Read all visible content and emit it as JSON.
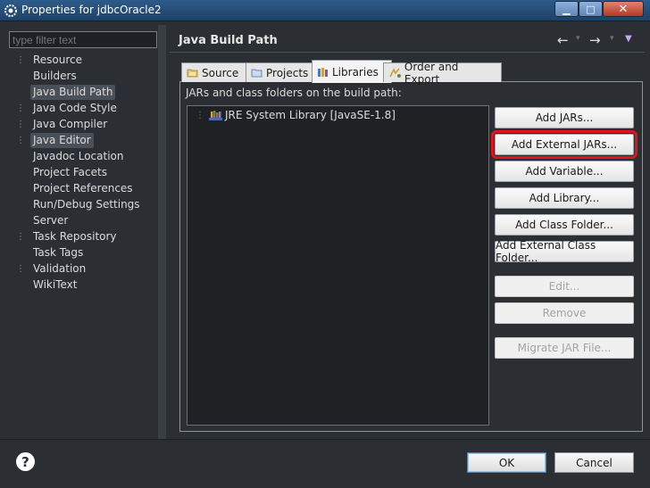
{
  "window": {
    "title": "Properties for jdbcOracle2",
    "icons": {
      "app": "gear-icon",
      "minimize": "minimize-icon",
      "maximize": "maximize-icon",
      "close": "close-icon"
    }
  },
  "filter": {
    "placeholder": "type filter text",
    "value": ""
  },
  "tree": {
    "items": [
      {
        "label": "Resource",
        "expandable": true,
        "selected": false
      },
      {
        "label": "Builders",
        "expandable": false,
        "selected": false
      },
      {
        "label": "Java Build Path",
        "expandable": false,
        "selected": true
      },
      {
        "label": "Java Code Style",
        "expandable": true,
        "selected": false
      },
      {
        "label": "Java Compiler",
        "expandable": true,
        "selected": false
      },
      {
        "label": "Java Editor",
        "expandable": true,
        "selected": true
      },
      {
        "label": "Javadoc Location",
        "expandable": false,
        "selected": false
      },
      {
        "label": "Project Facets",
        "expandable": false,
        "selected": false
      },
      {
        "label": "Project References",
        "expandable": false,
        "selected": false
      },
      {
        "label": "Run/Debug Settings",
        "expandable": false,
        "selected": false
      },
      {
        "label": "Server",
        "expandable": false,
        "selected": false
      },
      {
        "label": "Task Repository",
        "expandable": true,
        "selected": false
      },
      {
        "label": "Task Tags",
        "expandable": false,
        "selected": false
      },
      {
        "label": "Validation",
        "expandable": true,
        "selected": false
      },
      {
        "label": "WikiText",
        "expandable": false,
        "selected": false
      }
    ]
  },
  "page": {
    "title": "Java Build Path",
    "nav": {
      "back": "←",
      "forward": "→",
      "dropdown": "▾",
      "menu": "▼"
    }
  },
  "tabs": [
    {
      "label": "Source",
      "icon": "source-folder-icon",
      "active": false
    },
    {
      "label": "Projects",
      "icon": "projects-icon",
      "active": false
    },
    {
      "label": "Libraries",
      "icon": "libraries-icon",
      "active": true
    },
    {
      "label": "Order and Export",
      "icon": "order-export-icon",
      "active": false
    }
  ],
  "libraries": {
    "section_label": "JARs and class folders on the build path:",
    "entries": [
      {
        "label": "JRE System Library [JavaSE-1.8]",
        "icon": "library-icon"
      }
    ]
  },
  "buttons": {
    "add_jars": "Add JARs...",
    "add_external_jars": "Add External JARs...",
    "add_variable": "Add Variable...",
    "add_library": "Add Library...",
    "add_class_folder": "Add Class Folder...",
    "add_external_class_folder": "Add External Class Folder...",
    "edit": "Edit...",
    "remove": "Remove",
    "migrate_jar": "Migrate JAR File..."
  },
  "footer": {
    "help": "?",
    "ok": "OK",
    "cancel": "Cancel"
  },
  "colors": {
    "highlight": "#e0141b",
    "background": "#2b2f33",
    "titlebar": "#2d5b8a"
  }
}
